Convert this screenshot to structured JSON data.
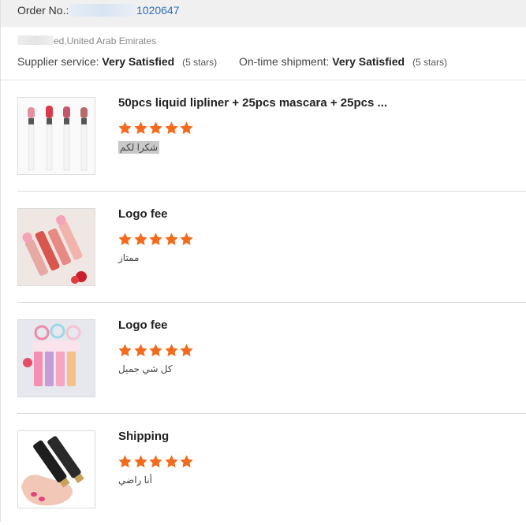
{
  "order": {
    "label": "Order No.:",
    "number": "1020647"
  },
  "location": {
    "text": "ed,United Arab Emirates"
  },
  "ratings": {
    "supplier_label": "Supplier service:",
    "supplier_value": "Very Satisfied",
    "supplier_stars": "(5 stars)",
    "shipment_label": "On-time shipment:",
    "shipment_value": "Very Satisfied",
    "shipment_stars": "(5 stars)"
  },
  "star_color": "#f26b1d",
  "items": [
    {
      "title": "50pcs liquid lipliner + 25pcs mascara + 25pcs ...",
      "rating": 5,
      "comment": "شكرا لكم",
      "image": "lip-liner-tubes-image"
    },
    {
      "title": "Logo fee",
      "rating": 5,
      "comment": "ممتاز",
      "image": "pink-lip-gloss-image"
    },
    {
      "title": "Logo fee",
      "rating": 5,
      "comment": "كل شي جميل",
      "image": "gradient-lip-gloss-image"
    },
    {
      "title": "Shipping",
      "rating": 5,
      "comment": "أنا راضي",
      "image": "hand-holding-tubes-image"
    }
  ]
}
